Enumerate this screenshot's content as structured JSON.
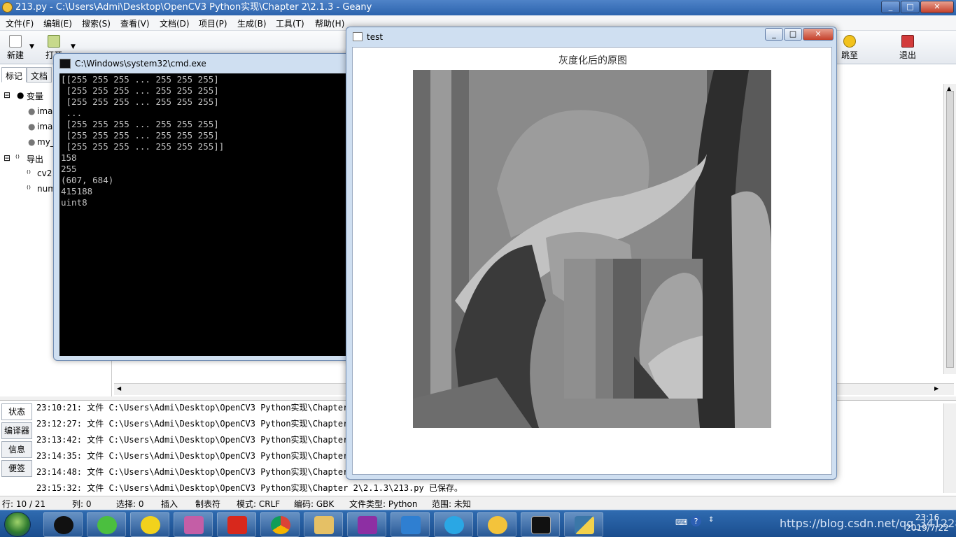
{
  "geany": {
    "title": "213.py - C:\\Users\\Admi\\Desktop\\OpenCV3 Python实现\\Chapter 2\\2.1.3 - Geany",
    "window_buttons": [
      "_",
      "□",
      "✕"
    ],
    "menu": [
      "文件(F)",
      "编辑(E)",
      "搜索(S)",
      "查看(V)",
      "文档(D)",
      "项目(P)",
      "生成(B)",
      "工具(T)",
      "帮助(H)"
    ],
    "toolbar": {
      "new": "新建",
      "open": "打开",
      "jump": "跳至",
      "quit": "退出"
    },
    "sidebar": {
      "tabs": [
        "标记",
        "文档"
      ],
      "tree": {
        "variables": "变量",
        "var_items": [
          "imag",
          "imag",
          "my_"
        ],
        "exports": "导出",
        "export_items": [
          "cv2",
          "num"
        ]
      }
    },
    "messages": {
      "tabs": [
        "状态",
        "编译器",
        "信息",
        "便签"
      ],
      "lines": [
        "23:10:21: 文件 C:\\Users\\Admi\\Desktop\\OpenCV3 Python实现\\Chapter",
        "23:12:27: 文件 C:\\Users\\Admi\\Desktop\\OpenCV3 Python实现\\Chapter",
        "23:13:42: 文件 C:\\Users\\Admi\\Desktop\\OpenCV3 Python实现\\Chapter",
        "23:14:35: 文件 C:\\Users\\Admi\\Desktop\\OpenCV3 Python实现\\Chapter",
        "23:14:48: 文件 C:\\Users\\Admi\\Desktop\\OpenCV3 Python实现\\Chapter",
        "23:15:32: 文件 C:\\Users\\Admi\\Desktop\\OpenCV3 Python实现\\Chapter 2\\2.1.3\\213.py 已保存。"
      ]
    },
    "status": {
      "line": "行: 10 / 21",
      "col": "列: 0",
      "sel": "选择: 0",
      "mode": "插入",
      "tab": "制表符",
      "eol": "模式: CRLF",
      "enc": "编码: GBK",
      "type": "文件类型: Python",
      "scope": "范围: 未知"
    }
  },
  "cmd": {
    "title": "C:\\Windows\\system32\\cmd.exe",
    "output": "[[255 255 255 ... 255 255 255]\n [255 255 255 ... 255 255 255]\n [255 255 255 ... 255 255 255]\n ...\n [255 255 255 ... 255 255 255]\n [255 255 255 ... 255 255 255]\n [255 255 255 ... 255 255 255]]\n158\n255\n(607, 684)\n415188\nuint8"
  },
  "test_window": {
    "title": "test",
    "image_title": "灰度化后的原图"
  },
  "taskbar": {
    "time": "23:16",
    "date": "2019/7/22",
    "watermark": "https://blog.csdn.net/qq_34122861",
    "apps": [
      "qq-icon",
      "wechat-icon",
      "music-icon",
      "reader-icon",
      "mail-icon",
      "chrome-icon",
      "explorer-icon",
      "pen-icon",
      "translate-icon",
      "ie-icon",
      "geany-icon",
      "cmd-icon",
      "python-icon"
    ]
  }
}
